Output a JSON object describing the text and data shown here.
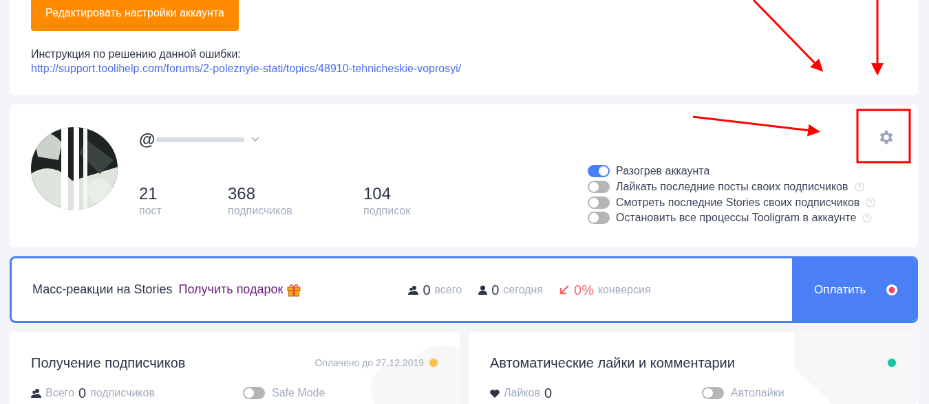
{
  "edit_button": "Редактировать настройки аккаунта",
  "instruction": {
    "text": "Инструкция по решению данной ошибки:",
    "link": "http://support.toolihelp.com/forums/2-poleznyie-stati/topics/48910-tehnicheskie-voprosyi/"
  },
  "profile": {
    "username": "@",
    "stats": [
      {
        "value": "21",
        "label": "пост"
      },
      {
        "value": "368",
        "label": "подписчиков"
      },
      {
        "value": "104",
        "label": "подписок"
      }
    ],
    "options": [
      {
        "label": "Разогрев аккаунта",
        "on": true,
        "help": false
      },
      {
        "label": "Лайкать последние посты своих подписчиков",
        "on": false,
        "help": true
      },
      {
        "label": "Смотреть последние Stories своих подписчиков",
        "on": false,
        "help": true
      },
      {
        "label": "Остановить все процессы Tooligram в аккаунте",
        "on": false,
        "help": true
      }
    ]
  },
  "stories_banner": {
    "title": "Масс-реакции на Stories",
    "gift_link": "Получить подарок",
    "stats": [
      {
        "kind": "total",
        "value": "0",
        "label": "всего"
      },
      {
        "kind": "today",
        "value": "0",
        "label": "сегодня"
      },
      {
        "kind": "conversion",
        "value": "0%",
        "label": "конверсия"
      }
    ],
    "pay_button": "Оплатить"
  },
  "cards": [
    {
      "kind": "followers",
      "title": "Получение подписчиков",
      "paid": "Оплачено до 27.12.2019",
      "color": "#f9c34a",
      "stat": {
        "prefix": "Всего",
        "value": "0",
        "suffix": "подписчиков"
      },
      "toggle": {
        "label": "Safe Mode",
        "on": false
      }
    },
    {
      "kind": "likes",
      "title": "Автоматические лайки и комментарии",
      "color": "#12c6a4",
      "stat": {
        "prefix": "Лайков",
        "value": "0"
      },
      "toggle": {
        "label": "Автолайки",
        "on": false
      }
    }
  ]
}
